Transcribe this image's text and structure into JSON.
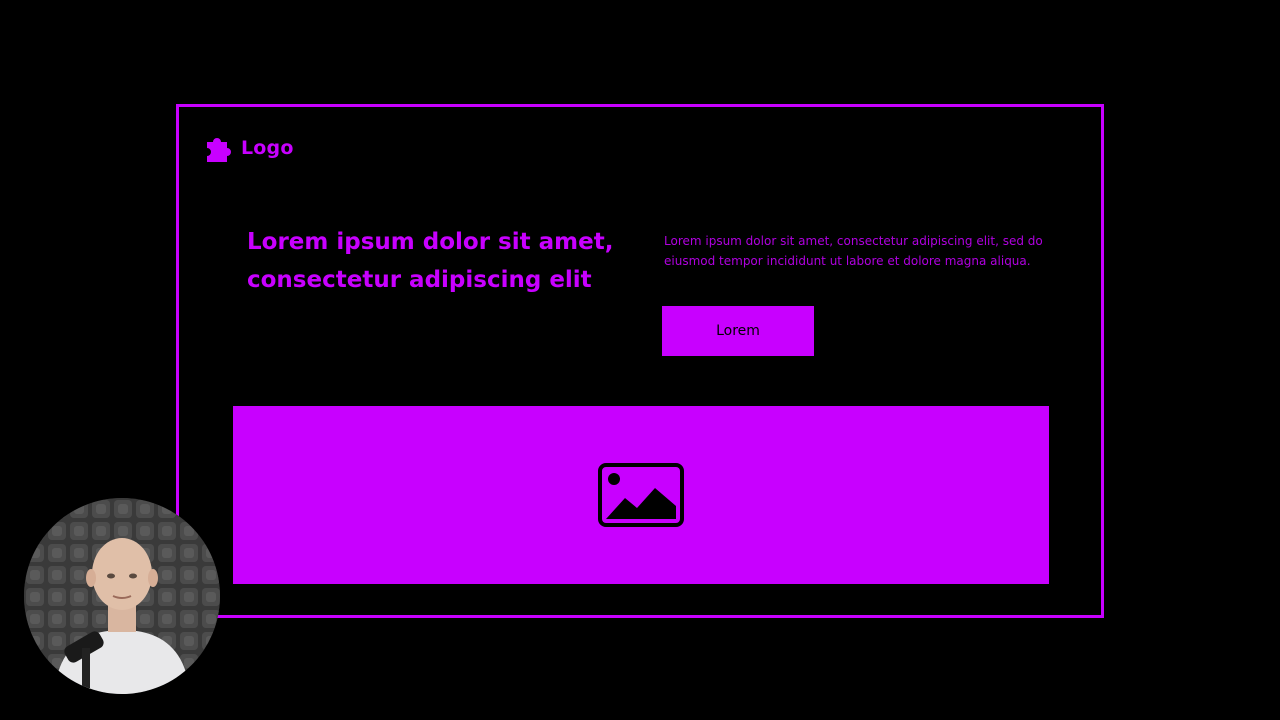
{
  "brand": {
    "logo_text": "Logo",
    "accent_color": "#c800ff",
    "background_color": "#000000"
  },
  "hero": {
    "headline": "Lorem ipsum dolor sit amet, consectetur adipiscing elit",
    "paragraph": "Lorem ipsum dolor sit amet, consectetur adipiscing elit, sed do eiusmod tempor incididunt ut labore et dolore magna aliqua.",
    "button_label": "Lorem"
  },
  "media": {
    "image_icon": "image-icon"
  },
  "overlay": {
    "webcam_icon": "presenter-webcam"
  }
}
